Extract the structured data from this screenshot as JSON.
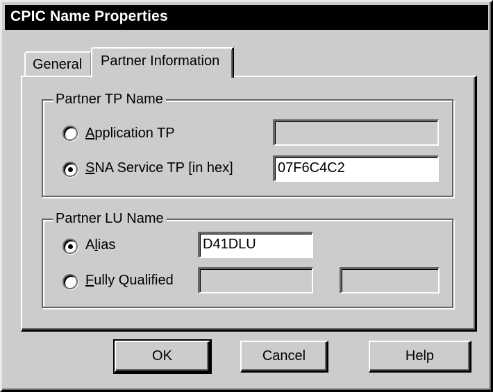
{
  "window": {
    "title": "CPIC Name Properties"
  },
  "tabs": [
    {
      "label": "General",
      "selected": false
    },
    {
      "label": "Partner Information",
      "selected": true
    }
  ],
  "partner_tp_group": {
    "legend": "Partner TP Name",
    "options": [
      {
        "label_prefix": "",
        "mnemonic": "A",
        "label_rest": "pplication TP",
        "checked": false,
        "field_value": "",
        "field_enabled": false
      },
      {
        "label_prefix": "",
        "mnemonic": "S",
        "label_rest": "NA Service TP [in hex]",
        "checked": true,
        "field_value": "07F6C4C2",
        "field_enabled": true
      }
    ]
  },
  "partner_lu_group": {
    "legend": "Partner LU Name",
    "alias": {
      "label_prefix": "A",
      "mnemonic": "l",
      "label_rest": "ias",
      "checked": true,
      "field_value": "D41DLU",
      "field_enabled": true
    },
    "fully_qualified": {
      "label_prefix": "",
      "mnemonic": "F",
      "label_rest": "ully Qualified",
      "checked": false,
      "network_value": "",
      "lu_value": "",
      "field_enabled": false
    }
  },
  "buttons": {
    "ok": "OK",
    "cancel": "Cancel",
    "help": "Help"
  }
}
